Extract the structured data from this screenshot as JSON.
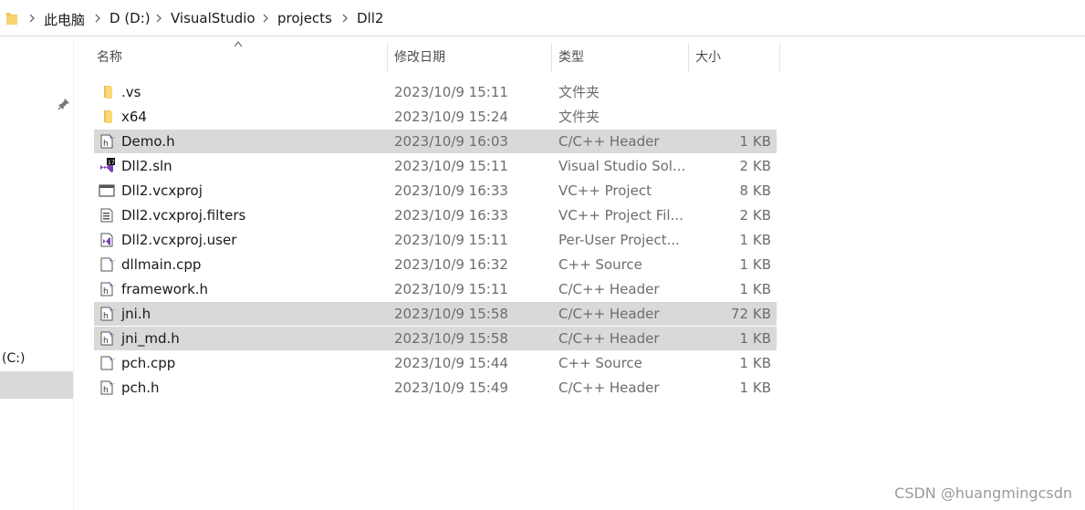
{
  "breadcrumb": [
    "此电脑",
    "D (D:)",
    "VisualStudio",
    "projects",
    "Dll2"
  ],
  "columns": {
    "name": "名称",
    "date": "修改日期",
    "type": "类型",
    "size": "大小"
  },
  "nav": {
    "drive_label": "(C:)"
  },
  "files": [
    {
      "name": ".vs",
      "date": "2023/10/9 15:11",
      "type": "文件夹",
      "size": "",
      "icon": "folder-icon",
      "selected": false
    },
    {
      "name": "x64",
      "date": "2023/10/9 15:24",
      "type": "文件夹",
      "size": "",
      "icon": "folder-icon",
      "selected": false
    },
    {
      "name": "Demo.h",
      "date": "2023/10/9 16:03",
      "type": "C/C++ Header",
      "size": "1 KB",
      "icon": "header-file-icon",
      "selected": true
    },
    {
      "name": "Dll2.sln",
      "date": "2023/10/9 15:11",
      "type": "Visual Studio Sol...",
      "size": "2 KB",
      "icon": "vs-solution-icon",
      "selected": false
    },
    {
      "name": "Dll2.vcxproj",
      "date": "2023/10/9 16:33",
      "type": "VC++ Project",
      "size": "8 KB",
      "icon": "vcxproj-icon",
      "selected": false
    },
    {
      "name": "Dll2.vcxproj.filters",
      "date": "2023/10/9 16:33",
      "type": "VC++ Project Fil...",
      "size": "2 KB",
      "icon": "filters-file-icon",
      "selected": false
    },
    {
      "name": "Dll2.vcxproj.user",
      "date": "2023/10/9 15:11",
      "type": "Per-User Project...",
      "size": "1 KB",
      "icon": "vs-user-file-icon",
      "selected": false
    },
    {
      "name": "dllmain.cpp",
      "date": "2023/10/9 16:32",
      "type": "C++ Source",
      "size": "1 KB",
      "icon": "source-file-icon",
      "selected": false
    },
    {
      "name": "framework.h",
      "date": "2023/10/9 15:11",
      "type": "C/C++ Header",
      "size": "1 KB",
      "icon": "header-file-icon",
      "selected": false
    },
    {
      "name": "jni.h",
      "date": "2023/10/9 15:58",
      "type": "C/C++ Header",
      "size": "72 KB",
      "icon": "header-file-icon",
      "selected": true
    },
    {
      "name": "jni_md.h",
      "date": "2023/10/9 15:58",
      "type": "C/C++ Header",
      "size": "1 KB",
      "icon": "header-file-icon",
      "selected": true
    },
    {
      "name": "pch.cpp",
      "date": "2023/10/9 15:44",
      "type": "C++ Source",
      "size": "1 KB",
      "icon": "source-file-icon",
      "selected": false
    },
    {
      "name": "pch.h",
      "date": "2023/10/9 15:49",
      "type": "C/C++ Header",
      "size": "1 KB",
      "icon": "header-file-icon",
      "selected": false
    }
  ],
  "watermark": "CSDN @huangmingcsdn"
}
